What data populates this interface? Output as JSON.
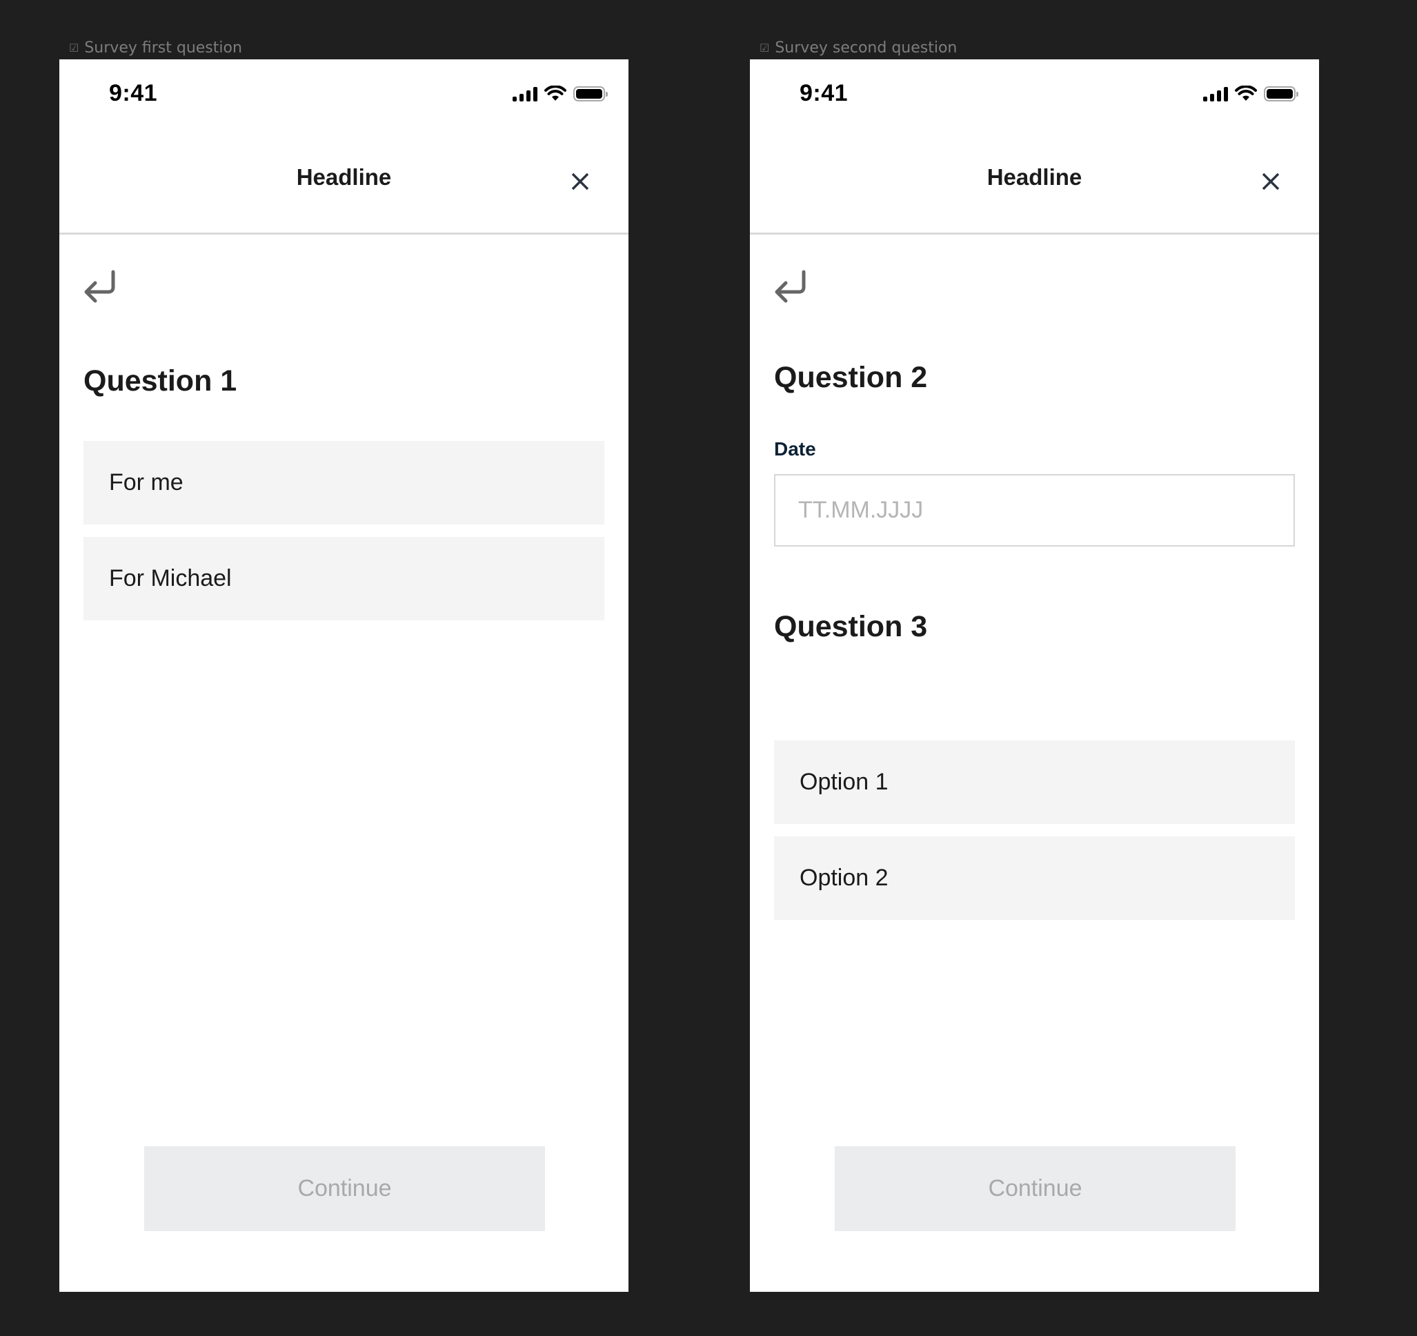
{
  "frames": [
    {
      "label": "Survey first question",
      "status_bar": {
        "time": "9:41",
        "icons": [
          "signal-icon",
          "wifi-icon",
          "battery-icon"
        ]
      },
      "header": {
        "title": "Headline",
        "close_icon": "close-icon"
      },
      "back_icon": "back-arrow-icon",
      "questions": [
        {
          "title": "Question 1",
          "options": [
            "For me",
            "For Michael"
          ]
        }
      ],
      "continue_label": "Continue"
    },
    {
      "label": "Survey second question",
      "status_bar": {
        "time": "9:41",
        "icons": [
          "signal-icon",
          "wifi-icon",
          "battery-icon"
        ]
      },
      "header": {
        "title": "Headline",
        "close_icon": "close-icon"
      },
      "back_icon": "back-arrow-icon",
      "questions": [
        {
          "title": "Question 2",
          "field_label": "Date",
          "field_value": "",
          "field_placeholder": "TT.MM.JJJJ"
        },
        {
          "title": "Question 3",
          "options": [
            "Option 1",
            "Option 2"
          ]
        }
      ],
      "continue_label": "Continue"
    }
  ],
  "colors": {
    "canvas_bg": "#1f1f1f",
    "option_bg": "#f4f4f4",
    "button_disabled_bg": "#ebecee",
    "button_disabled_text": "#a9a9a9",
    "field_label": "#0d2236",
    "close_icon": "#2b3340"
  }
}
